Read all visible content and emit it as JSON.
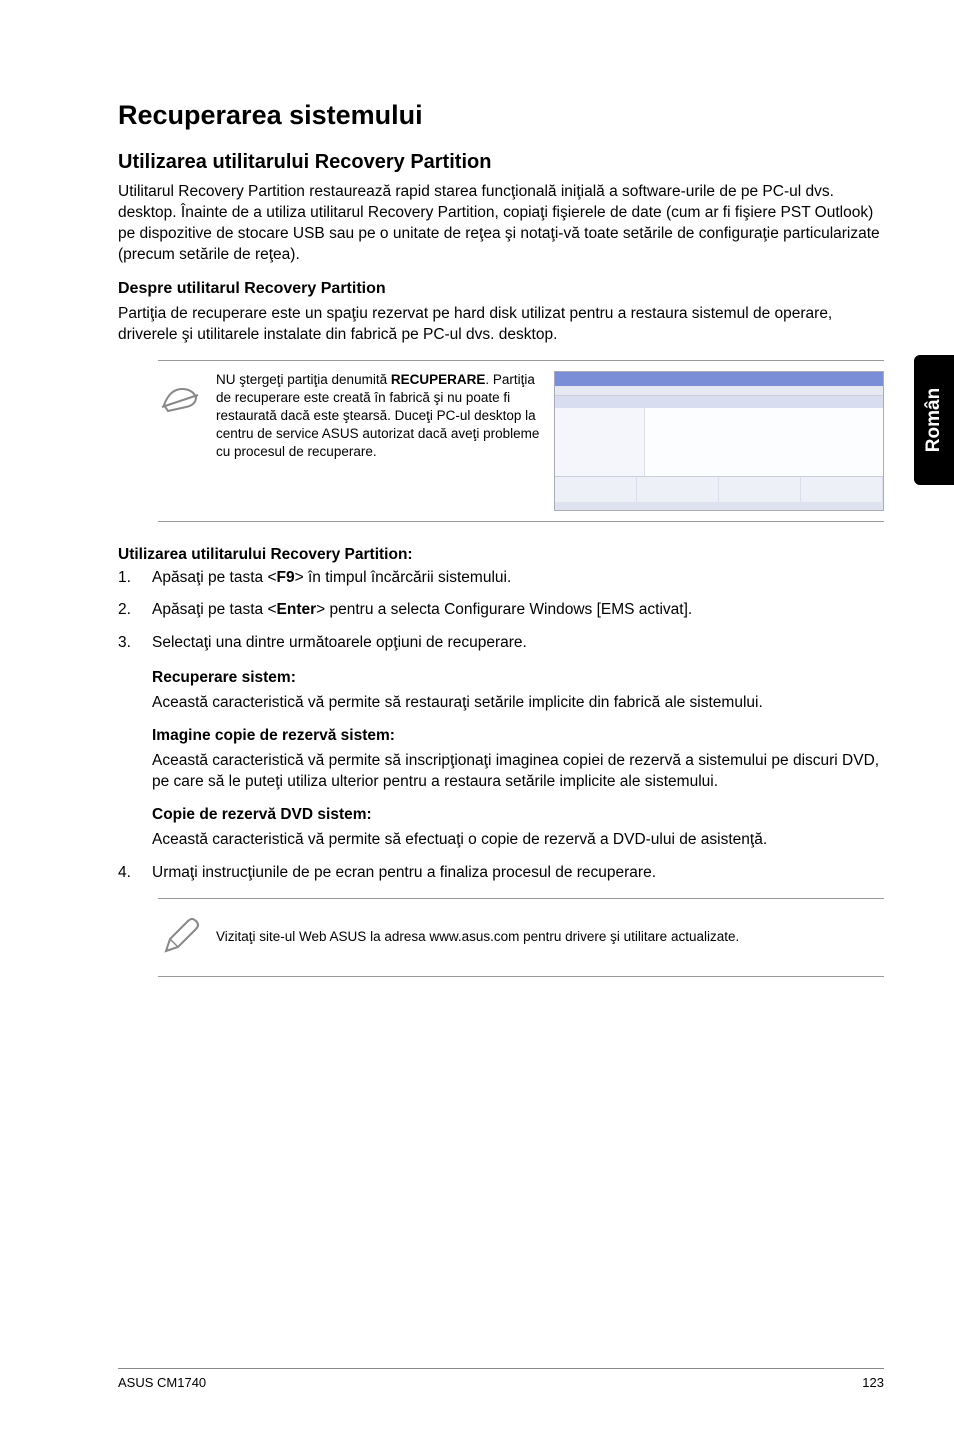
{
  "side_tab": "Român",
  "h1": "Recuperarea sistemului",
  "h2": "Utilizarea utilitarului Recovery Partition",
  "intro": "Utilitarul Recovery Partition restaurează rapid starea funcţională iniţială a software-urile de pe PC-ul dvs. desktop. Înainte de a utiliza utilitarul Recovery Partition, copiaţi fişierele de date (cum ar fi fişiere PST Outlook) pe dispozitive de stocare USB sau pe o unitate de reţea şi notaţi-vă toate setările de configuraţie particularizate (precum setările de reţea).",
  "h3_about": "Despre utilitarul Recovery Partition",
  "about_p": "Partiţia de recuperare este un spaţiu rezervat pe hard disk utilizat pentru a restaura sistemul de operare, driverele şi utilitarele instalate din fabrică pe PC-ul dvs. desktop.",
  "note1_pre": "NU ştergeţi partiţia denumită ",
  "note1_bold": "RECUPERARE",
  "note1_post": ". Partiţia de recuperare este creată în fabrică şi nu poate fi restaurată dacă este ştearsă. Duceţi PC-ul desktop la centru de service ASUS autorizat dacă aveţi probleme cu procesul de recuperare.",
  "h4_using": "Utilizarea utilitarului Recovery Partition:",
  "step1_a": "Apăsaţi pe tasta <",
  "step1_b": "F9",
  "step1_c": "> în timpul încărcării sistemului.",
  "step2_a": "Apăsaţi pe tasta <",
  "step2_b": "Enter",
  "step2_c": "> pentru a selecta Configurare Windows [EMS activat].",
  "step3": "Selectaţi una dintre următoarele opţiuni de recuperare.",
  "opt1_title": "Recuperare sistem:",
  "opt1_body": "Această caracteristică vă permite să restauraţi setările implicite din fabrică ale sistemului.",
  "opt2_title": "Imagine copie de rezervă sistem:",
  "opt2_body": "Această caracteristică vă permite să inscripţionaţi imaginea copiei de rezervă a sistemului pe discuri DVD, pe care să le puteţi utiliza ulterior pentru a restaura setările implicite ale sistemului.",
  "opt3_title": "Copie de rezervă DVD sistem:",
  "opt3_body": "Această caracteristică vă permite să efectuaţi o copie de rezervă a DVD-ului de asistenţă.",
  "step4": "Urmaţi instrucţiunile de pe ecran pentru a finaliza procesul de recuperare.",
  "note2": "Vizitaţi site-ul Web ASUS la adresa www.asus.com pentru drivere şi utilitare actualizate.",
  "footer_left": "ASUS CM1740",
  "footer_right": "123"
}
